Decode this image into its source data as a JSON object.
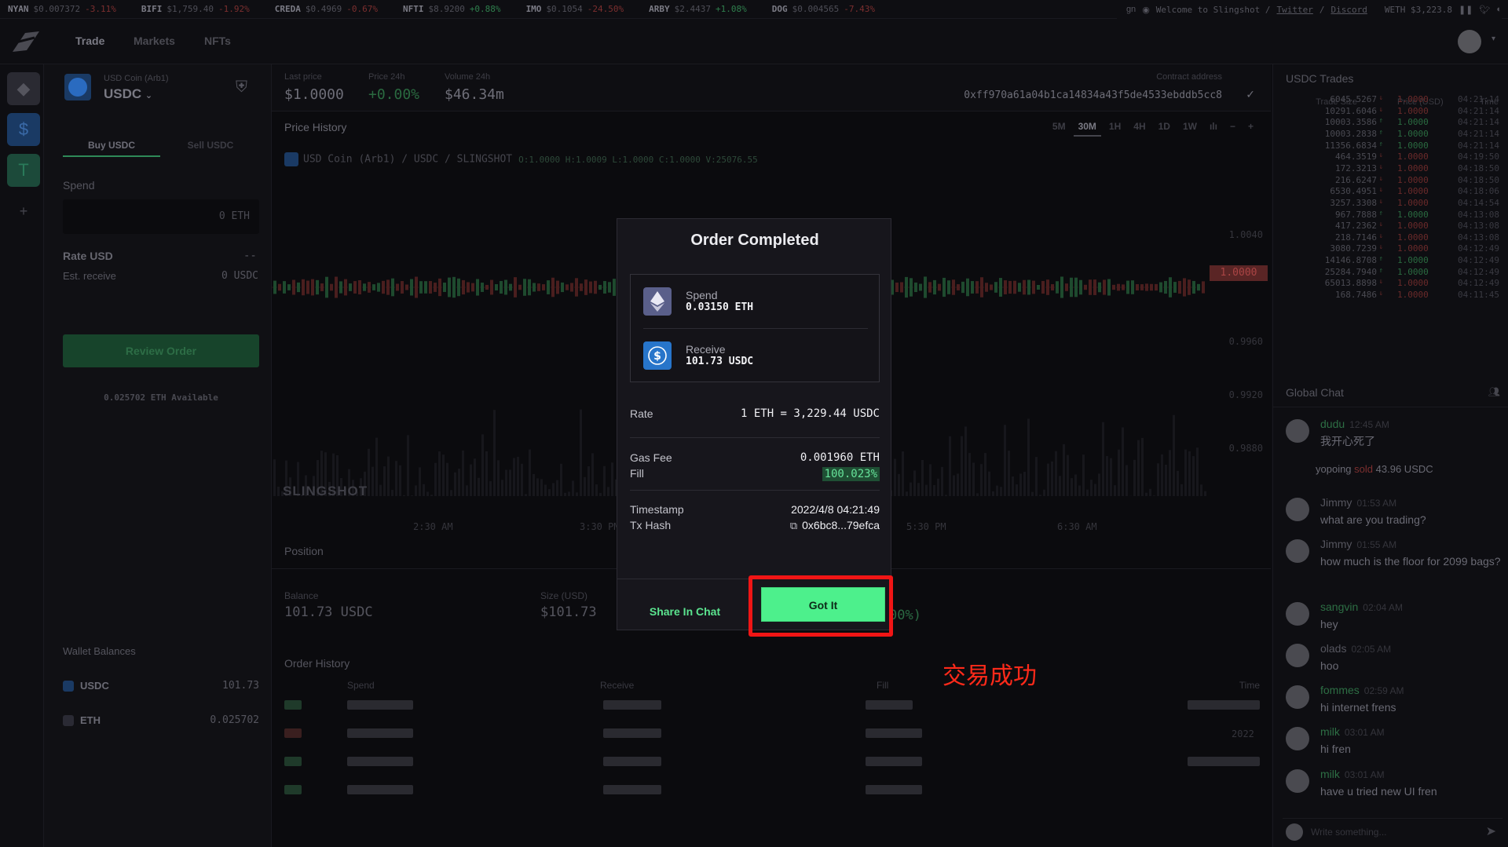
{
  "ticker": [
    {
      "sym": "NYAN",
      "price": "$0.007372",
      "chg": "-3.11%",
      "dir": "down"
    },
    {
      "sym": "BIFI",
      "price": "$1,759.40",
      "chg": "-1.92%",
      "dir": "down"
    },
    {
      "sym": "CREDA",
      "price": "$0.4969",
      "chg": "-0.67%",
      "dir": "down"
    },
    {
      "sym": "NFTI",
      "price": "$8.9200",
      "chg": "+0.88%",
      "dir": "up"
    },
    {
      "sym": "IMO",
      "price": "$0.1054",
      "chg": "-24.50%",
      "dir": "down"
    },
    {
      "sym": "ARBY",
      "price": "$2.4437",
      "chg": "+1.08%",
      "dir": "up"
    },
    {
      "sym": "DOG",
      "price": "$0.004565",
      "chg": "-7.43%",
      "dir": "down"
    }
  ],
  "ticker_right": {
    "gn": "gn",
    "welcome": "Welcome to Slingshot /",
    "twitter": "Twitter",
    "slash": "/",
    "discord": "Discord",
    "weth": "WETH $3,223.8"
  },
  "nav": {
    "trade": "Trade",
    "markets": "Markets",
    "nfts": "NFTs"
  },
  "coin": {
    "sub": "USD Coin (Arb1)",
    "name": "USDC"
  },
  "side_tabs": {
    "buy": "Buy USDC",
    "sell": "Sell USDC"
  },
  "order_form": {
    "spend_label": "Spend",
    "spend_value": "0 ETH",
    "rate_label": "Rate USD",
    "rate_value": "--",
    "est_label": "Est. receive",
    "est_value": "0 USDC",
    "review_button": "Review Order",
    "available": "0.025702 ETH Available"
  },
  "wallet": {
    "title": "Wallet Balances",
    "rows": [
      {
        "sym": "USDC",
        "amount": "101.73"
      },
      {
        "sym": "ETH",
        "amount": "0.025702"
      }
    ]
  },
  "stats": {
    "last_price_label": "Last price",
    "last_price": "$1.0000",
    "price24_label": "Price 24h",
    "price24": "+0.00%",
    "volume_label": "Volume 24h",
    "volume": "$46.34m",
    "contract_label": "Contract address",
    "contract": "0xff970a61a04b1ca14834a43f5de4533ebddb5cc8"
  },
  "chart": {
    "title": "Price History",
    "timeframes": [
      "5M",
      "30M",
      "1H",
      "4H",
      "1D",
      "1W"
    ],
    "active_timeframe": "30M",
    "legend": "USD Coin (Arb1) / USDC / SLINGSHOT",
    "ohlc": "O:1.0000 H:1.0009 L:1.0000 C:1.0000 V:25076.55",
    "price_tag": "1.0000",
    "y_ticks": [
      "1.0040",
      "0.9960",
      "0.9920",
      "0.9880"
    ],
    "x_ticks": [
      "2:30 AM",
      "3:30 PM",
      "5:30 PM",
      "6:30 AM"
    ],
    "watermark": "SLINGSHOT"
  },
  "position": {
    "title": "Position",
    "balance_label": "Balance",
    "balance": "101.73 USDC",
    "size_label": "Size (USD)",
    "size": "$101.73",
    "pct_fragment": "00%)"
  },
  "order_history": {
    "title": "Order History",
    "cols": [
      "Spend",
      "Receive",
      "Fill",
      "Time"
    ],
    "partial_time": "2022"
  },
  "trades": {
    "title": "USDC Trades",
    "headers": [
      "Trade Size",
      "Price (USD)",
      "Time"
    ],
    "rows": [
      {
        "size": "6045.5267",
        "price": "1.0000",
        "time": "04:21:14",
        "dir": "down"
      },
      {
        "size": "10291.6046",
        "price": "1.0000",
        "time": "04:21:14",
        "dir": "down"
      },
      {
        "size": "10003.3586",
        "price": "1.0000",
        "time": "04:21:14",
        "dir": "up"
      },
      {
        "size": "10003.2838",
        "price": "1.0000",
        "time": "04:21:14",
        "dir": "up"
      },
      {
        "size": "11356.6834",
        "price": "1.0000",
        "time": "04:21:14",
        "dir": "up"
      },
      {
        "size": "464.3519",
        "price": "1.0000",
        "time": "04:19:50",
        "dir": "down"
      },
      {
        "size": "172.3213",
        "price": "1.0000",
        "time": "04:18:50",
        "dir": "down"
      },
      {
        "size": "216.6247",
        "price": "1.0000",
        "time": "04:18:50",
        "dir": "down"
      },
      {
        "size": "6530.4951",
        "price": "1.0000",
        "time": "04:18:06",
        "dir": "down"
      },
      {
        "size": "3257.3308",
        "price": "1.0000",
        "time": "04:14:54",
        "dir": "down"
      },
      {
        "size": "967.7888",
        "price": "1.0000",
        "time": "04:13:08",
        "dir": "up"
      },
      {
        "size": "417.2362",
        "price": "1.0000",
        "time": "04:13:08",
        "dir": "down"
      },
      {
        "size": "218.7146",
        "price": "1.0000",
        "time": "04:13:08",
        "dir": "down"
      },
      {
        "size": "3080.7239",
        "price": "1.0000",
        "time": "04:12:49",
        "dir": "down"
      },
      {
        "size": "14146.8708",
        "price": "1.0000",
        "time": "04:12:49",
        "dir": "up"
      },
      {
        "size": "25284.7940",
        "price": "1.0000",
        "time": "04:12:49",
        "dir": "up"
      },
      {
        "size": "65013.8898",
        "price": "1.0000",
        "time": "04:12:49",
        "dir": "down"
      },
      {
        "size": "168.7486",
        "price": "1.0000",
        "time": "04:11:45",
        "dir": "down"
      }
    ]
  },
  "chat": {
    "title": "Global Chat",
    "messages": [
      {
        "user": "dudu",
        "time": "12:45 AM",
        "text": "我开心死了",
        "green": true
      },
      {
        "user": "Jimmy",
        "time": "01:53 AM",
        "text": "what are you trading?",
        "green": false
      },
      {
        "user": "Jimmy",
        "time": "01:55 AM",
        "text": "how much is the floor for 2099 bags?",
        "green": false
      },
      {
        "user": "sangvin",
        "time": "02:04 AM",
        "text": "hey",
        "green": true
      },
      {
        "user": "olads",
        "time": "02:05 AM",
        "text": "hoo",
        "green": false
      },
      {
        "user": "fommes",
        "time": "02:59 AM",
        "text": "hi internet frens",
        "green": true
      },
      {
        "user": "milk",
        "time": "03:01 AM",
        "text": "hi fren",
        "green": true
      },
      {
        "user": "milk",
        "time": "03:01 AM",
        "text": "have u tried new UI fren",
        "green": true
      }
    ],
    "system": {
      "user": "yopoing",
      "action": "sold",
      "amount": "43.96 USDC"
    },
    "input_placeholder": "Write something..."
  },
  "modal": {
    "title": "Order Completed",
    "spend_label": "Spend",
    "spend_amount": "0.03150 ETH",
    "receive_label": "Receive",
    "receive_amount": "101.73 USDC",
    "rate_label": "Rate",
    "rate_value": "1 ETH = 3,229.44 USDC",
    "gas_label": "Gas Fee",
    "gas_value": "0.001960 ETH",
    "fill_label": "Fill",
    "fill_value": "100.023%",
    "timestamp_label": "Timestamp",
    "timestamp_value": "2022/4/8 04:21:49",
    "txhash_label": "Tx Hash",
    "txhash_value": "0x6bc8...79efca",
    "share_button": "Share In Chat",
    "got_it_button": "Got It"
  },
  "annotation": "交易成功",
  "colors": {
    "accent_green": "#4df08c",
    "highlight_red": "#f01515",
    "up": "#2a6a40",
    "down": "#6a2a2a"
  }
}
